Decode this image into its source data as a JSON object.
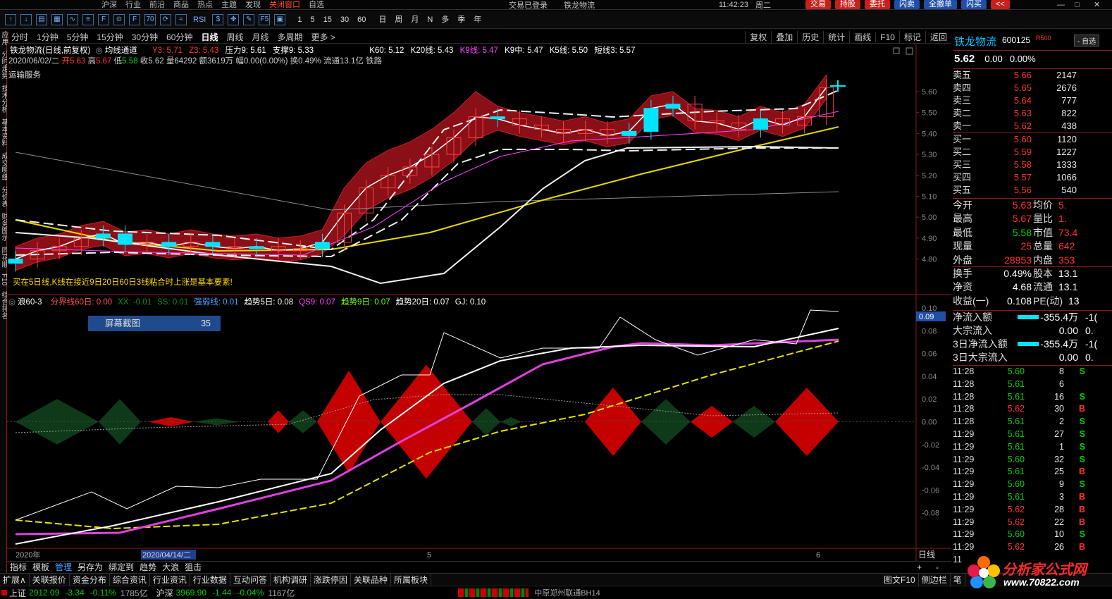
{
  "menu": {
    "items": [
      "沪深",
      "行业",
      "前沿",
      "商品",
      "热点",
      "主题",
      "发现",
      "关闭窗口",
      "自选"
    ],
    "center": "交易已登录",
    "stock": "铁龙物流",
    "clock": "11:42:23",
    "weekday": "周二",
    "trade_buttons": [
      "交易",
      "持股",
      "委托",
      "闪卖",
      "全撤单",
      "闪买",
      "<<"
    ]
  },
  "toolbar": {
    "icons": [
      "arrow-up-icon",
      "arrow-down-icon",
      "document-icon",
      "grid-icon",
      "chart-icon",
      "list-icon",
      "f10-icon",
      "compass-icon",
      "f10b-icon",
      "f70-icon",
      "refresh-icon",
      "wave-icon",
      "rsi-icon",
      "dollar-icon",
      "cross-icon",
      "pen-icon",
      "f5-icon",
      "picture-icon"
    ],
    "rsi": "RSI",
    "counts": [
      "1",
      "5",
      "15",
      "30",
      "60"
    ],
    "periods": [
      "日",
      "周",
      "月",
      "N",
      "多",
      "季",
      "年"
    ]
  },
  "period_bar": {
    "tabs": [
      "分时",
      "1分钟",
      "5分钟",
      "15分钟",
      "30分钟",
      "60分钟",
      "日线",
      "周线",
      "月线",
      "多周期",
      "更多 >"
    ],
    "active": "日线",
    "right": [
      "复权",
      "叠加",
      "历史",
      "统计",
      "画线",
      "F10",
      "标记",
      "返回"
    ]
  },
  "left_strip": [
    "应用",
    "分时走势",
    "技术分析",
    "基本资料",
    "成交明细",
    "分价表",
    "财务图示",
    "同花顺",
    "F10",
    "综合排名"
  ],
  "main_info": {
    "line1": {
      "name": "铁龙物流(日线,前复权)",
      "indicator": "均线通道",
      "y3": "Y3: 5.71",
      "z3": "Z3: 5.43",
      "press": "压力9: 5.61",
      "support": "支撑9: 5.33",
      "k60": "K60: 5.12",
      "k20": "K20线: 5.43",
      "k9": "K9线: 5.47",
      "k9m": "K9中: 5.47",
      "k5": "K5线: 5.50",
      "short": "短线3: 5.57"
    },
    "line2": {
      "date": "2020/06/02/二",
      "open_l": "开",
      "open": "5.63",
      "high_l": "高",
      "high": "5.67",
      "low_l": "低",
      "low": "5.58",
      "close_l": "收",
      "close": "5.62",
      "vol_l": "量",
      "vol": "64292",
      "amt": "额3619万",
      "chg": "幅0.00(0.00%)",
      "turn": "换0.49%",
      "float": "流通13.1亿",
      "industry": "铁路"
    },
    "sector": "运输服务",
    "note": "买在5日线,K线在接近9日20日60日3线粘合时上涨是基本要素!",
    "price_axis": [
      "5.60",
      "5.50",
      "5.40",
      "5.30",
      "5.20",
      "5.10",
      "5.00",
      "4.90",
      "4.80"
    ]
  },
  "sub_info": {
    "name": "浪60-3",
    "items": [
      {
        "t": "分界线60日: 0.00",
        "c": "#ff5050"
      },
      {
        "t": "XX: -0.01",
        "c": "#1a8a1a"
      },
      {
        "t": "SS: 0.01",
        "c": "#1a8a1a"
      },
      {
        "t": "强弱线: 0.01",
        "c": "#4aa0ff"
      },
      {
        "t": "趋势5日: 0.08",
        "c": "#ffffff"
      },
      {
        "t": "QS9: 0.07",
        "c": "#ff40ff"
      },
      {
        "t": "趋势9日: 0.07",
        "c": "#7cfc00"
      },
      {
        "t": "趋势20日: 0.07",
        "c": "#ffffff"
      },
      {
        "t": "GJ: 0.10",
        "c": "#ffffff"
      }
    ],
    "screenshot_label": "屏幕截图",
    "screenshot_num": "35",
    "cur_value": "0.09",
    "axis": [
      "0.10",
      "0.08",
      "0.06",
      "0.04",
      "0.02",
      "0.00",
      "-0.02",
      "-0.04",
      "-0.06",
      "-0.08"
    ],
    "xaxis": {
      "year": "2020年",
      "date": "2020/04/14/二",
      "m5": "5",
      "m6": "6",
      "period": "日线"
    }
  },
  "quote": {
    "name": "铁龙物流",
    "code": "600125",
    "badge": "R500",
    "zixuan": "- 自选",
    "price": "5.62",
    "change": "0.00",
    "pct": "0.00%",
    "asks": [
      {
        "l": "卖五",
        "p": "5.66",
        "v": "2147"
      },
      {
        "l": "卖四",
        "p": "5.65",
        "v": "2676"
      },
      {
        "l": "卖三",
        "p": "5.64",
        "v": "777"
      },
      {
        "l": "卖二",
        "p": "5.63",
        "v": "822"
      },
      {
        "l": "卖一",
        "p": "5.62",
        "v": "438"
      }
    ],
    "bids": [
      {
        "l": "买一",
        "p": "5.60",
        "v": "1120"
      },
      {
        "l": "买二",
        "p": "5.59",
        "v": "1227"
      },
      {
        "l": "买三",
        "p": "5.58",
        "v": "1333"
      },
      {
        "l": "买四",
        "p": "5.57",
        "v": "1066"
      },
      {
        "l": "买五",
        "p": "5.56",
        "v": "540"
      }
    ],
    "stats": [
      {
        "l": "今开",
        "v": "5.63",
        "c": "red",
        "l2": "均价",
        "v2": "5."
      },
      {
        "l": "最高",
        "v": "5.67",
        "c": "red",
        "l2": "量比",
        "v2": "1."
      },
      {
        "l": "最低",
        "v": "5.58",
        "c": "green",
        "l2": "市值",
        "v2": "73.4"
      },
      {
        "l": "现量",
        "v": "25",
        "c": "red",
        "l2": "总量",
        "v2": "642"
      },
      {
        "l": "外盘",
        "v": "28953",
        "c": "red",
        "l2": "内盘",
        "v2": "353"
      }
    ],
    "stats2": [
      {
        "l": "换手",
        "v": "0.49%",
        "l2": "股本",
        "v2": "13.1"
      },
      {
        "l": "净资",
        "v": "4.68",
        "l2": "流通",
        "v2": "13.1"
      },
      {
        "l": "收益(一)",
        "v": "0.108",
        "l2": "PE(动)",
        "v2": "13"
      }
    ],
    "flows": [
      {
        "l": "净流入额",
        "v": "-355.4万",
        "v2": "-1("
      },
      {
        "l": "大宗流入",
        "v": "0.00",
        "v2": "0."
      },
      {
        "l": "3日净流入额",
        "v": "-355.4万",
        "v2": "-1("
      },
      {
        "l": "3日大宗流入",
        "v": "0.00",
        "v2": "0."
      }
    ],
    "ticks": [
      {
        "t": "11:28",
        "p": "5.60",
        "v": "8",
        "s": "S"
      },
      {
        "t": "11:28",
        "p": "5.61",
        "v": "6",
        "s": ""
      },
      {
        "t": "11:28",
        "p": "5.61",
        "v": "16",
        "s": "S"
      },
      {
        "t": "11:28",
        "p": "5.62",
        "v": "30",
        "s": "B"
      },
      {
        "t": "11:28",
        "p": "5.61",
        "v": "2",
        "s": "S"
      },
      {
        "t": "11:29",
        "p": "5.61",
        "v": "27",
        "s": "S"
      },
      {
        "t": "11:29",
        "p": "5.61",
        "v": "1",
        "s": "S"
      },
      {
        "t": "11:29",
        "p": "5.60",
        "v": "32",
        "s": "S"
      },
      {
        "t": "11:29",
        "p": "5.61",
        "v": "25",
        "s": "B"
      },
      {
        "t": "11:29",
        "p": "5.60",
        "v": "9",
        "s": "S"
      },
      {
        "t": "11:29",
        "p": "5.61",
        "v": "3",
        "s": "B"
      },
      {
        "t": "11:29",
        "p": "5.62",
        "v": "28",
        "s": "B"
      },
      {
        "t": "11:29",
        "p": "5.62",
        "v": "22",
        "s": "B"
      },
      {
        "t": "11:29",
        "p": "5.60",
        "v": "10",
        "s": "S"
      },
      {
        "t": "11:29",
        "p": "5.62",
        "v": "26",
        "s": "B"
      },
      {
        "t": "11",
        "p": "",
        "v": "",
        "s": ""
      }
    ]
  },
  "bottom_tabs": [
    "指标",
    "模板",
    "管理",
    "另存为",
    "绑定到",
    "趋势",
    "大浪",
    "狙击"
  ],
  "bottom_tabs_active": "管理",
  "bottom_tabs_right": [
    "+",
    "-"
  ],
  "bar2": {
    "left": [
      "扩展∧",
      "关联报价",
      "资金分布",
      "综合资讯",
      "行业资讯",
      "行业数据",
      "互动问答",
      "机构调研",
      "涨跌停因",
      "关联品种",
      "所属板块"
    ],
    "right": [
      "图文F10",
      "侧边栏",
      "笔"
    ]
  },
  "status": {
    "sh_l": "上证",
    "sh_v": "2912.09",
    "sh_c": "-3.34",
    "sh_p": "-0.11%",
    "sh_a": "1785亿",
    "hs_l": "沪深",
    "hs_v": "3969.90",
    "hs_c": "-1.44",
    "hs_p": "-0.04%",
    "hs_a": "1167亿",
    "ticker": "中原郑州联通BH14"
  },
  "watermark": {
    "text": "分析家公式网",
    "url": "www.70822.com"
  }
}
